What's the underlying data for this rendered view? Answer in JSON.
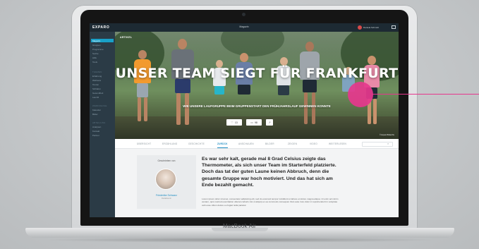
{
  "app": {
    "logo": "EXPARO",
    "topbar_title": "Magazin",
    "user_name": "Daniela Schmidt"
  },
  "sidebar": {
    "items": [
      {
        "label": "Magazin",
        "active": true
      },
      {
        "label": "Gruppen"
      },
      {
        "label": "Programme"
      },
      {
        "label": "Suche"
      },
      {
        "label": "Hilfe"
      },
      {
        "label": "Tools"
      }
    ],
    "section_1": "THEMEN",
    "section_1_items": [
      "Erfahrung",
      "Wellness",
      "Touren",
      "Schlafen",
      "Gesundheit",
      "Lauf-B"
    ],
    "section_2": "WERKZEUGE",
    "section_2_items": [
      "Kalender",
      "Bilder"
    ],
    "section_3": "ABTEILUNG",
    "section_3_items": [
      "Analysen",
      "Kontakt",
      "Partner"
    ]
  },
  "hero": {
    "label": "ARTIKEL",
    "title": "UNSER TEAM SIEGT FÜR FRANKFURT",
    "subtitle": "WIE UNSERE LAUFGRUPPE BEIM GRUPPENSTART DEN FRÜHJAHRSLAUF GEWINNEN KONNTE",
    "stat_likes": "13",
    "stat_comments": "98",
    "credit": "© Exparo Bildarchiv"
  },
  "tabs": [
    "ÜBERSICHT",
    "ERZÄHLUNG",
    "GESCHICHTE",
    "ZURÜCK",
    "ANSCHAUEN",
    "BILDER",
    "ZEIGEN",
    "VIDEO",
    "WEITERLESEN"
  ],
  "active_tab": "ZURÜCK",
  "article": {
    "author_heading": "Geschrieben von",
    "author_name": "Friederike Schwarz",
    "author_role": "Redakteurin",
    "lead": "Es war sehr kalt, gerade mal 8 Grad Celsius zeigte das Thermometer, als sich unser Team im Starterfeld platzierte. Doch das tat der guten Laune keinen Abbruch, denn die gesamte Gruppe war hoch motiviert. Und das hat sich am Ende bezahlt gemacht.",
    "body": "Lorem ipsum dolor sit amet, consectetur adipiscing elit, sed do eiusmod tempor incididunt ut labore et dolore magna aliqua. Ut enim ad minim veniam, quis nostrud exercitation ullamco laboris nisi ut aliquip ex ea commodo consequat. Duis aute irure dolor in reprehenderit in voluptate velit esse cillum dolore eu fugiat nulla pariatur."
  },
  "device": {
    "brand": "MacBook Air"
  },
  "colors": {
    "accent": "#1d8cc2",
    "callout": "#e6378d",
    "sidebar": "#2b3b46",
    "topbar": "#1d2a33"
  }
}
